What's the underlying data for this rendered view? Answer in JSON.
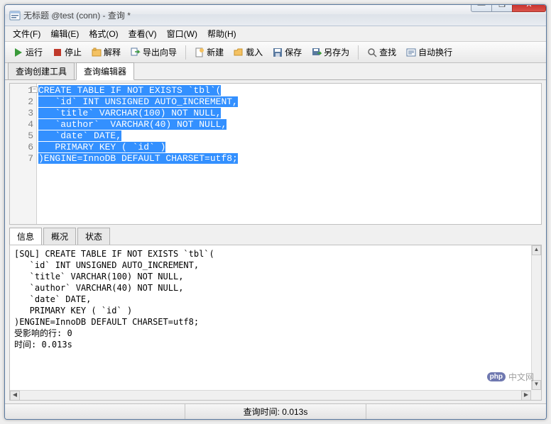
{
  "window": {
    "title": "无标题 @test (conn) - 查询 *",
    "controls": {
      "min": "—",
      "max": "❐",
      "close": "✕"
    }
  },
  "menu": {
    "file": "文件(F)",
    "edit": "编辑(E)",
    "format": "格式(O)",
    "view": "查看(V)",
    "window": "窗口(W)",
    "help": "帮助(H)"
  },
  "toolbar": {
    "run": "运行",
    "stop": "停止",
    "explain": "解释",
    "export": "导出向导",
    "new": "新建",
    "load": "载入",
    "save": "保存",
    "saveas": "另存为",
    "find": "查找",
    "wrap": "自动换行"
  },
  "editor_tabs": {
    "builder": "查询创建工具",
    "editor": "查询编辑器"
  },
  "code": {
    "lines": [
      "CREATE TABLE IF NOT EXISTS `tbl`(",
      "   `id` INT UNSIGNED AUTO_INCREMENT,",
      "   `title` VARCHAR(100) NOT NULL,",
      "   `author`  VARCHAR(40) NOT NULL,",
      "   `date` DATE,",
      "   PRIMARY KEY ( `id` )",
      ")ENGINE=InnoDB DEFAULT CHARSET=utf8;"
    ],
    "line_numbers": [
      "1",
      "2",
      "3",
      "4",
      "5",
      "6",
      "7"
    ]
  },
  "result_tabs": {
    "info": "信息",
    "profile": "概况",
    "status": "状态"
  },
  "result": {
    "lines": [
      "[SQL] CREATE TABLE IF NOT EXISTS `tbl`(",
      "   `id` INT UNSIGNED AUTO_INCREMENT,",
      "   `title` VARCHAR(100) NOT NULL,",
      "   `author` VARCHAR(40) NOT NULL,",
      "   `date` DATE,",
      "   PRIMARY KEY ( `id` )",
      ")ENGINE=InnoDB DEFAULT CHARSET=utf8;",
      "受影响的行: 0",
      "时间: 0.013s"
    ]
  },
  "statusbar": {
    "query_time": "查询时间: 0.013s"
  },
  "watermark": {
    "php": "php",
    "text": "中文网"
  }
}
